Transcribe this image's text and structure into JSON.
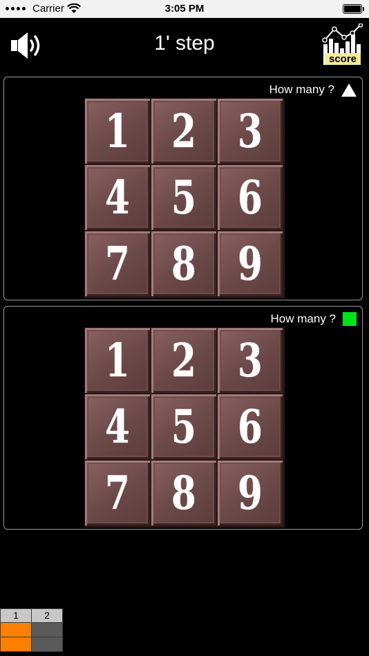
{
  "status_bar": {
    "carrier": "Carrier",
    "time": "3:05 PM"
  },
  "header": {
    "title": "1' step",
    "score_label": "score",
    "speaker_icon": "speaker-icon",
    "score_icon": "score-chart-icon"
  },
  "panels": [
    {
      "question": "How many ?",
      "shape": "triangle",
      "shape_color": "#ffffff",
      "tiles": [
        "1",
        "2",
        "3",
        "4",
        "5",
        "6",
        "7",
        "8",
        "9"
      ]
    },
    {
      "question": "How many ?",
      "shape": "square",
      "shape_color": "#00e21a",
      "tiles": [
        "1",
        "2",
        "3",
        "4",
        "5",
        "6",
        "7",
        "8",
        "9"
      ]
    }
  ],
  "progress": {
    "columns": [
      "1",
      "2"
    ],
    "rows": [
      [
        "#ff7f00",
        "#5a5a5a"
      ],
      [
        "#ff7f00",
        "#5a5a5a"
      ]
    ]
  }
}
